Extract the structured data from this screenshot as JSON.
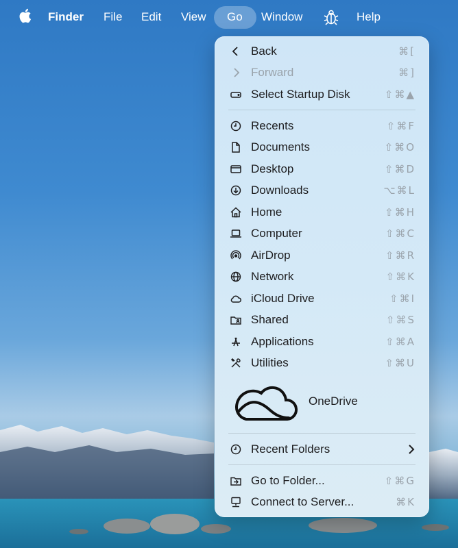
{
  "menubar": {
    "apple_icon": "apple-icon",
    "app_name": "Finder",
    "items": [
      "File",
      "Edit",
      "View",
      "Go",
      "Window"
    ],
    "bug_icon": "bug-icon",
    "help": "Help"
  },
  "go_menu": {
    "items": [
      {
        "label": "Back",
        "shortcut": "⌘[",
        "icon": "chevron-left-icon"
      },
      {
        "label": "Forward",
        "shortcut": "⌘]",
        "icon": "chevron-right-icon",
        "disabled": true
      },
      {
        "label": "Select Startup Disk",
        "shortcut": "⇧⌘▲",
        "icon": "disk-icon"
      },
      {
        "label": "Recents",
        "shortcut": "⇧⌘F",
        "icon": "clock-icon"
      },
      {
        "label": "Documents",
        "shortcut": "⇧⌘O",
        "icon": "document-icon"
      },
      {
        "label": "Desktop",
        "shortcut": "⇧⌘D",
        "icon": "desktop-icon"
      },
      {
        "label": "Downloads",
        "shortcut": "⌥⌘L",
        "icon": "download-icon"
      },
      {
        "label": "Home",
        "shortcut": "⇧⌘H",
        "icon": "home-icon"
      },
      {
        "label": "Computer",
        "shortcut": "⇧⌘C",
        "icon": "laptop-icon"
      },
      {
        "label": "AirDrop",
        "shortcut": "⇧⌘R",
        "icon": "airdrop-icon"
      },
      {
        "label": "Network",
        "shortcut": "⇧⌘K",
        "icon": "network-icon"
      },
      {
        "label": "iCloud Drive",
        "shortcut": "⇧⌘I",
        "icon": "cloud-icon"
      },
      {
        "label": "Shared",
        "shortcut": "⇧⌘S",
        "icon": "shared-folder-icon"
      },
      {
        "label": "Applications",
        "shortcut": "⇧⌘A",
        "icon": "applications-icon"
      },
      {
        "label": "Utilities",
        "shortcut": "⇧⌘U",
        "icon": "utilities-icon"
      },
      {
        "label": "OneDrive",
        "icon": "onedrive-icon"
      },
      {
        "label": "Recent Folders",
        "icon": "clock-icon",
        "submenu_icon": "chevron-right-icon"
      },
      {
        "label": "Go to Folder...",
        "shortcut": "⇧⌘G",
        "icon": "go-to-folder-icon"
      },
      {
        "label": "Connect to Server...",
        "shortcut": "⌘K",
        "icon": "server-icon"
      }
    ]
  },
  "colors": {
    "menu_text": "#1d1d1f",
    "shortcut_text": "#9aa3ab",
    "menubar_text": "#ffffff"
  }
}
